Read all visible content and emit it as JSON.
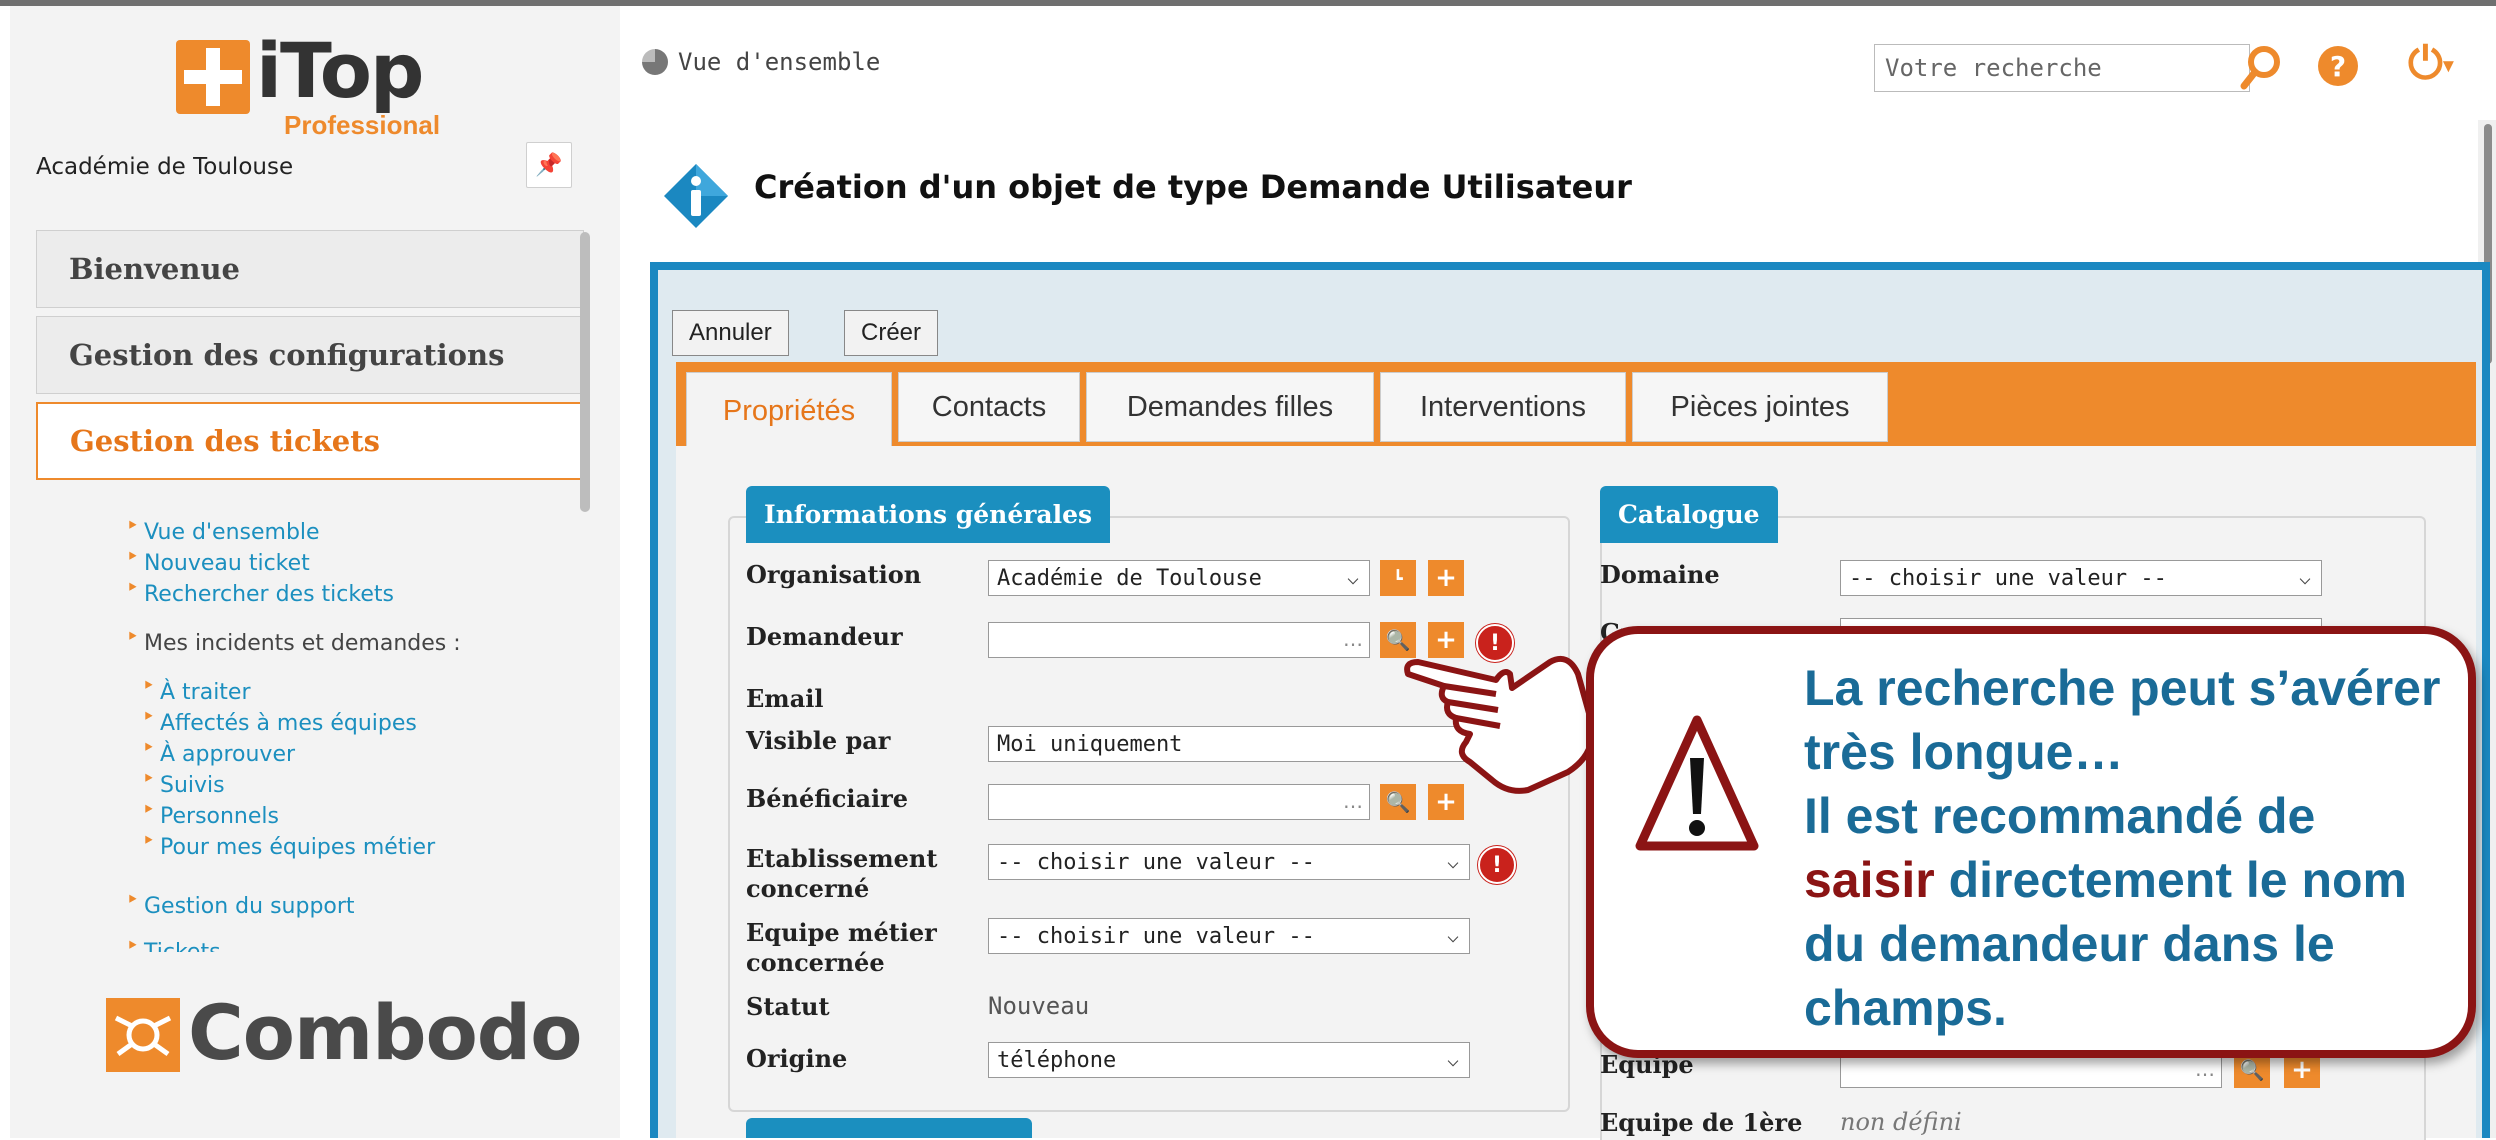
{
  "sidebar": {
    "logo": {
      "name": "iTop",
      "edition": "Professional"
    },
    "organization": "Académie de Toulouse",
    "menu": [
      {
        "label": "Bienvenue"
      },
      {
        "label": "Gestion des configurations"
      },
      {
        "label": "Gestion des tickets"
      }
    ],
    "submenu": {
      "overview": "Vue d'ensemble",
      "new_ticket": "Nouveau ticket",
      "search_tickets": "Rechercher des tickets",
      "my_incidents": "Mes incidents et demandes :",
      "todo": "À traiter",
      "assigned_teams": "Affectés à mes équipes",
      "to_approve": "À approuver",
      "followed": "Suivis",
      "personal": "Personnels",
      "business_teams": "Pour mes équipes métier",
      "support": "Gestion du support",
      "cut_off": "Tickets ............"
    },
    "footer_logo": "Combodo"
  },
  "topbar": {
    "overview": "Vue d'ensemble",
    "search_placeholder": "Votre recherche"
  },
  "page": {
    "title": "Création d'un objet de type Demande Utilisateur",
    "buttons": {
      "cancel": "Annuler",
      "create": "Créer"
    },
    "tabs": [
      {
        "label": "Propriétés",
        "active": true
      },
      {
        "label": "Contacts"
      },
      {
        "label": "Demandes filles"
      },
      {
        "label": "Interventions"
      },
      {
        "label": "Pièces jointes"
      }
    ]
  },
  "general_info": {
    "legend": "Informations générales",
    "organisation": {
      "label": "Organisation",
      "value": "Académie de Toulouse"
    },
    "demandeur": {
      "label": "Demandeur",
      "value": ""
    },
    "email": {
      "label": "Email"
    },
    "visible_par": {
      "label": "Visible par",
      "value": "Moi uniquement"
    },
    "beneficiaire": {
      "label": "Bénéficiaire",
      "value": ""
    },
    "etablissement": {
      "label_1": "Etablissement",
      "label_2": "concerné",
      "value": "-- choisir une valeur --"
    },
    "equipe_metier": {
      "label_1": "Equipe métier",
      "label_2": "concernée",
      "value": "-- choisir une valeur --"
    },
    "statut": {
      "label": "Statut",
      "value": "Nouveau"
    },
    "origine": {
      "label": "Origine",
      "value": "téléphone"
    }
  },
  "catalogue": {
    "legend": "Catalogue",
    "domaine": {
      "label": "Domaine",
      "value": "-- choisir une valeur --"
    },
    "second_label_partial": "Gr",
    "equipe": {
      "label": "Equipe"
    },
    "equipe_1ere": {
      "label": "Equipe de 1ère",
      "value": "non défini"
    }
  },
  "callout": {
    "line1": "La recherche peut s’avérer",
    "line2": "très longue…",
    "line3": "Il est recommandé de",
    "emphasis": "saisir",
    "line4_rest": " directement le nom",
    "line5": "du demandeur dans le",
    "line6": "champs."
  },
  "colors": {
    "accent_orange": "#ee8a2c",
    "itop_blue": "#1b88c1",
    "callout_red": "#8b1414",
    "callout_text": "#1a6b97",
    "required_red": "#c9221c"
  }
}
